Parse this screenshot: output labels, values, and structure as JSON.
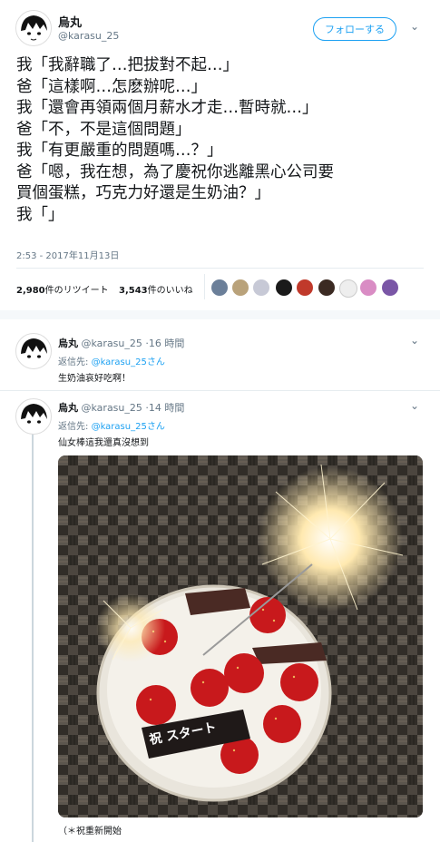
{
  "main_tweet": {
    "name": "烏丸",
    "handle": "@karasu_25",
    "follow_label": "フォローする",
    "lines": [
      "我「我辭職了…把拔對不起…」",
      "爸「這樣啊…怎麽辦呢…」",
      "我「還會再領兩個月薪水才走…暫時就…」",
      "爸「不，不是這個問題」",
      "我「有更嚴重的問題嗎…？」",
      "爸「嗯，我在想，為了慶祝你逃離黑心公司要",
      "買個蛋糕，巧克力好還是生奶油？」",
      "我「」"
    ],
    "timestamp": "2:53 - 2017年11月13日",
    "retweet_count": "2,980",
    "retweet_label": "件のリツイート",
    "like_count": "3,543",
    "like_label": "件のいいね"
  },
  "likers": [
    {
      "color": "#6b7f99"
    },
    {
      "color": "#b9a27a"
    },
    {
      "color": "#c7c9d6"
    },
    {
      "color": "#1a1a1a"
    },
    {
      "color": "#c0392b"
    },
    {
      "color": "#3b2a22"
    },
    {
      "color": "#eeeeee"
    },
    {
      "color": "#d98cc4"
    },
    {
      "color": "#7a56a6"
    }
  ],
  "replies": [
    {
      "name": "烏丸",
      "handle": "@karasu_25",
      "time": "·16 時間",
      "reply_to_label": "返信先:",
      "reply_to_handle": "@karasu_25さん",
      "text": "生奶油哀好吃啊！"
    },
    {
      "name": "烏丸",
      "handle": "@karasu_25",
      "time": "·14 時間",
      "reply_to_label": "返信先:",
      "reply_to_handle": "@karasu_25さん",
      "text": "仙女棒這我還真沒想到",
      "photo_cake_label": "祝 スタート",
      "caption": "（＊祝重新開始"
    }
  ],
  "colors": {
    "accent": "#1da1f2",
    "muted": "#657786",
    "divider": "#e6ecf0"
  }
}
